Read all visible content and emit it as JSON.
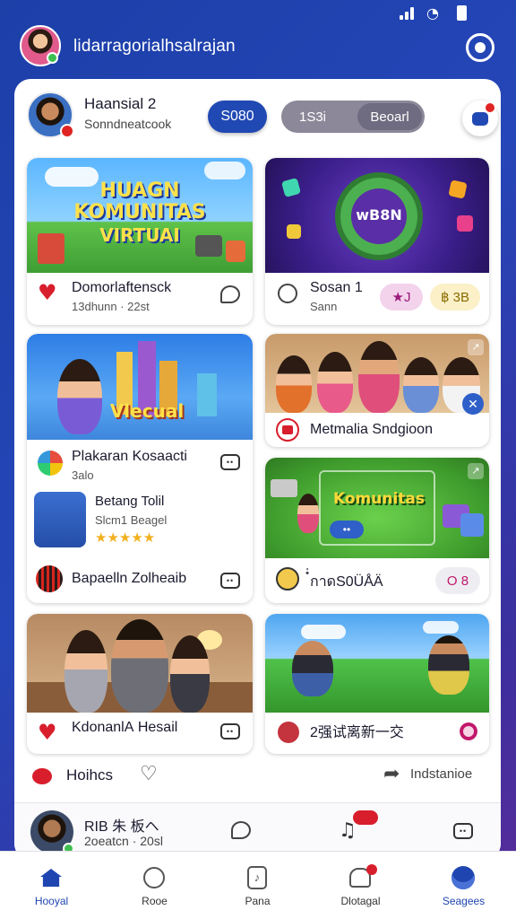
{
  "app": {
    "title": "lidarragorialhsalrajan"
  },
  "profile": {
    "name": "Haansial 2",
    "subtitle": "Sonndneatcook",
    "pill_blue": "S080",
    "pill_grey_left": "1S3i",
    "pill_grey_right": "Beoarl"
  },
  "cards": {
    "c1": {
      "banner_line1": "HUAGN",
      "banner_line2": "KOMUNITAS",
      "banner_line3": "VIRTUAI",
      "title": "Domorlaftensck",
      "subtitle": "13dhunn · 22st"
    },
    "c2": {
      "banner": "wB8N",
      "title": "Sosan 1",
      "subtitle": "Sann",
      "tag1": "★J",
      "tag2": "฿ 3B"
    },
    "c3": {
      "banner": "Vlecual",
      "title": "Plakaran Kosaacti",
      "subtitle": "3alo",
      "sub_title": "Betang Tolil",
      "sub_subtitle": "Slcm1 Beagel",
      "stars": "★★★★★",
      "footer": "Bapaelln Zolheaib"
    },
    "c4": {
      "title": "Metmalia Sndgioon"
    },
    "c5": {
      "banner": "Komunitas",
      "btn": "••",
      "title": "๋่กาดS0ÜÅÄ",
      "tag": "O 8"
    },
    "c6": {
      "title": "KdonanlА Hesail"
    },
    "c7": {
      "title": "2强试离新一交"
    }
  },
  "feed": {
    "left": "Hoihcs",
    "right": "Indstanioe"
  },
  "mini": {
    "title": "RIB 朱 板ヘ",
    "subtitle": "2oeatcn · 20sl"
  },
  "nav": [
    {
      "label": "Hooyal",
      "icon": "home-icon"
    },
    {
      "label": "Rooe",
      "icon": "people-icon"
    },
    {
      "label": "Pana",
      "icon": "music-icon"
    },
    {
      "label": "Dlotagal",
      "icon": "notifications-icon"
    },
    {
      "label": "Seagees",
      "icon": "profile-icon"
    }
  ],
  "colors": {
    "primary": "#1f46b0",
    "accent_red": "#d81e2c",
    "background_gradient_end": "#5a2c9a"
  }
}
